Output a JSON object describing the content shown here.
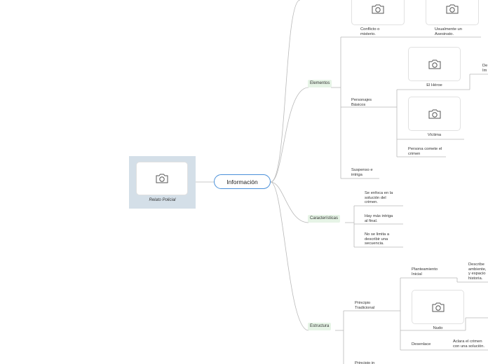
{
  "map": {
    "root": {
      "label": "Relato Policial",
      "icon": "camera-icon"
    },
    "center": {
      "label": "Información"
    },
    "topics": {
      "elementos": {
        "label": "Elementos",
        "top_items": [
          {
            "label": "Conflicto o misterio.",
            "icon": "camera-icon"
          },
          {
            "label": "Usualmente un Asesinato.",
            "icon": "camera-icon"
          }
        ],
        "personajes": {
          "label": "Personajes Básicos",
          "heroe": {
            "label": "El Héroe",
            "note": "De Im",
            "icon": "camera-icon"
          },
          "victima": {
            "label": "Víctima",
            "icon": "camera-icon"
          },
          "comete": "Persona comete el crimen"
        },
        "suspenso": "Suspenso e intriga"
      },
      "caracteristicas": {
        "label": "Características",
        "items": [
          "Se enfoca en la solución del crimen.",
          "Hay más intriga al final.",
          "No se limita a describir una secuencia."
        ]
      },
      "estructura": {
        "label": "Estructura",
        "principio": {
          "label": "Principio Tradicional",
          "planteamiento": {
            "label": "Planteamiento Inicial",
            "note": "Describe ambiente, y espacio historia."
          },
          "nudo": {
            "label": "Nudo",
            "icon": "camera-icon"
          },
          "desenlace": {
            "label": "Desenlace",
            "note": "Aclara el crimen con una solución."
          }
        },
        "partial": "Principio in"
      }
    }
  }
}
